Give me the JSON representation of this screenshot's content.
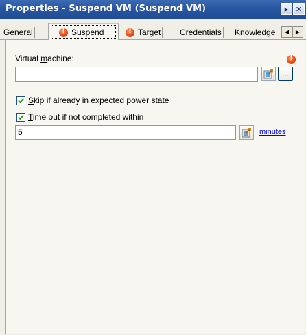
{
  "window": {
    "title": "Properties - Suspend VM (Suspend VM)",
    "dock_glyph": "▸",
    "close_glyph": "✕"
  },
  "tabs": [
    {
      "label": "General",
      "has_error": false
    },
    {
      "label": "Suspend",
      "has_error": true,
      "active": true
    },
    {
      "label": "Target",
      "has_error": true
    },
    {
      "label": "Credentials",
      "has_error": false
    },
    {
      "label": "Knowledge",
      "has_error": false
    }
  ],
  "tab_scroll": {
    "left_glyph": "◀",
    "right_glyph": "▶"
  },
  "suspend": {
    "vm_label_prefix": "Virtual ",
    "vm_label_accel": "m",
    "vm_label_suffix": "achine:",
    "vm_value": "",
    "vm_required_icon": "error-icon",
    "ellipsis_label": "...",
    "skip_checked": true,
    "skip_accel": "S",
    "skip_label": "kip if already in expected power state",
    "timeout_checked": true,
    "timeout_accel": "T",
    "timeout_label": "ime out if not completed within",
    "timeout_value": "5",
    "units_link": "minutes"
  },
  "colors": {
    "titlebar": "#2a57a3",
    "error": "#e84b12",
    "link": "#0000ff"
  }
}
